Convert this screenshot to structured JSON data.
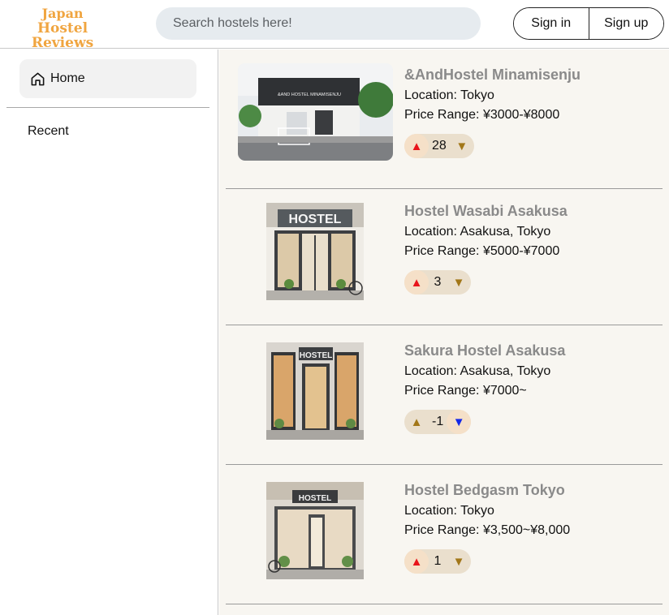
{
  "header": {
    "logo_line1": "Japan",
    "logo_line2": "Hostel Reviews",
    "search_placeholder": "Search hostels here!",
    "sign_in": "Sign in",
    "sign_up": "Sign up"
  },
  "sidebar": {
    "home_label": "Home",
    "home_icon": "home-icon",
    "recent_label": "Recent"
  },
  "colors": {
    "logo": "#f0a540",
    "upvote_active": "#e8141b",
    "downvote_active": "#1428e8",
    "vote_inactive": "#a27719",
    "vote_pill": "#eadfcd",
    "main_bg": "#f8f6f1"
  },
  "hostels": [
    {
      "name": "&AndHostel Minamisenju",
      "location": "Location: Tokyo",
      "price": "Price Range: ¥3000-¥8000",
      "votes": "28",
      "vote_state": "up",
      "up_icon": "upvote-icon",
      "down_icon": "downvote-icon"
    },
    {
      "name": "Hostel Wasabi Asakusa",
      "location": "Location: Asakusa, Tokyo",
      "price": "Price Range: ¥5000-¥7000",
      "votes": "3",
      "vote_state": "up",
      "up_icon": "upvote-icon",
      "down_icon": "downvote-icon"
    },
    {
      "name": "Sakura Hostel Asakusa",
      "location": "Location: Asakusa, Tokyo",
      "price": "Price Range: ¥7000~",
      "votes": "-1",
      "vote_state": "down",
      "up_icon": "upvote-icon",
      "down_icon": "downvote-icon"
    },
    {
      "name": "Hostel Bedgasm Tokyo",
      "location": "Location: Tokyo",
      "price": "Price Range: ¥3,500~¥8,000",
      "votes": "1",
      "vote_state": "up",
      "up_icon": "upvote-icon",
      "down_icon": "downvote-icon"
    }
  ],
  "photos": {
    "sign1": "&AND HOSTEL MINAMISENJU",
    "sign2": "HOSTEL",
    "sign3": "HOSTEL",
    "sign4": "HOSTEL"
  }
}
